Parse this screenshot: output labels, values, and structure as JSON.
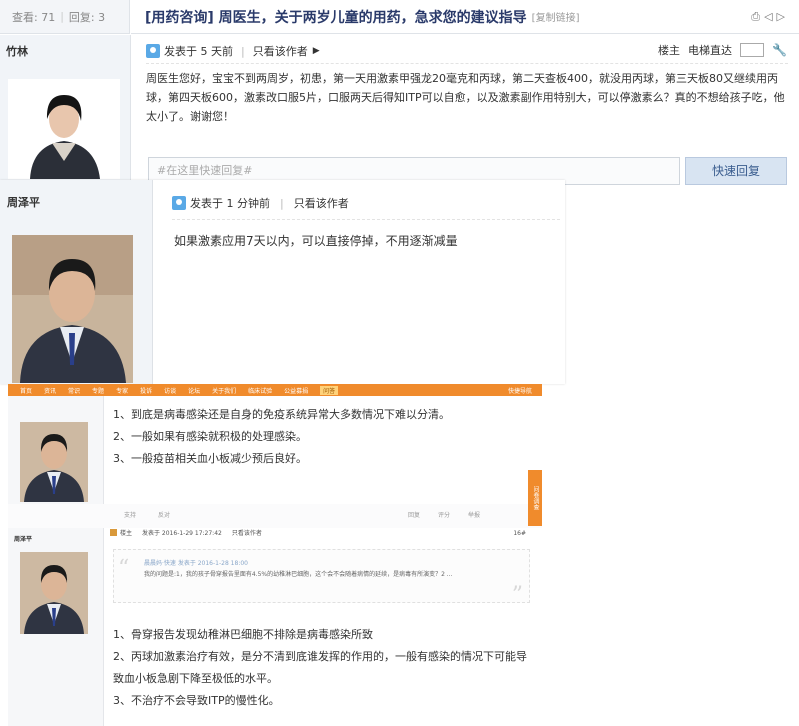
{
  "panel1": {
    "stats": {
      "views_label": "查看: 71",
      "replies_label": "回复: 3"
    },
    "title": "[用药咨询] 周医生，关于两岁儿童的用药，急求您的建议指导",
    "copy_link": "[复制链接]",
    "toolbar_icons": [
      "print-icon",
      "prev-icon",
      "next-icon"
    ],
    "author": "竹林",
    "meta": {
      "posted": "发表于 5 天前",
      "only_author": "只看该作者"
    },
    "right_meta": {
      "floor": "楼主",
      "jump": "电梯直达"
    },
    "body": "周医生您好，宝宝不到两周岁，初患，第一天用激素甲强龙20毫克和丙球，第二天查板400，就没用丙球，第三天板80又继续用丙球，第四天板600，激素改口服5片，口服两天后得知ITP可以自愈，以及激素副作用特别大，可以停激素么？真的不想给孩子吃，他太小了。谢谢您！",
    "reply_placeholder": "#在这里快速回复#",
    "reply_button": "快速回复"
  },
  "panel2": {
    "author": "周泽平",
    "meta": {
      "posted": "发表于 1 分钟前",
      "only_author": "只看该作者"
    },
    "body": "如果激素应用7天以内，可以直接停掉，不用逐渐减量"
  },
  "panel3": {
    "nav_items": [
      "首页",
      "资讯",
      "常识",
      "专题",
      "专家",
      "投诉",
      "访谈",
      "论坛",
      "关于我们",
      "临床试验",
      "公益募捐",
      "问答"
    ],
    "nav_right": "快捷导航",
    "reply1": [
      "1、到底是病毒感染还是自身的免疫系统异常大多数情况下难以分清。",
      "2、一般如果有感染就积极的处理感染。",
      "3、一般疫苗相关血小板减少预后良好。"
    ],
    "mid_actions": [
      "支持",
      "反对",
      "回复",
      "评分",
      "举报"
    ],
    "side_tab": "问卷调查",
    "author2": "周泽平",
    "meta2": {
      "floor_tag": "楼主",
      "posted": "发表于 2016-1-29 17:27:42",
      "only_author": "只看该作者",
      "floor": "16#"
    },
    "quote": {
      "header": "晨晨妈·快速 发表于 2016-1-28 18:00",
      "text": "我的问题是:1，我的孩子骨穿报告里面有4.5%的幼稚淋巴细胞，这个会不会随着病情的延续，是病毒有所演变？2 ..."
    },
    "reply2": [
      "1、骨穿报告发现幼稚淋巴细胞不排除是病毒感染所致",
      "2、丙球加激素治疗有效，是分不清到底谁发挥的作用的，一般有感染的情况下可能导致血小板急剧下降至极低的水平。",
      "3、不治疗不会导致ITP的慢性化。"
    ]
  }
}
